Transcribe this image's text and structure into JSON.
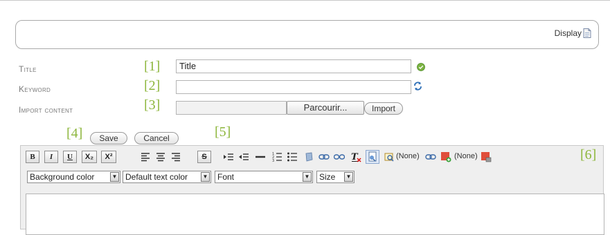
{
  "header": {
    "display_label": "Display"
  },
  "fields": {
    "title": {
      "label": "Title",
      "value": "Title"
    },
    "keyword": {
      "label": "Keyword",
      "value": ""
    },
    "import": {
      "label": "Import content",
      "browse_label": "Parcourir...",
      "import_button": "Import"
    }
  },
  "actions": {
    "save": "Save",
    "cancel": "Cancel"
  },
  "markers": {
    "m1": "[1]",
    "m2": "[2]",
    "m3": "[3]",
    "m4": "[4]",
    "m5": "[5]",
    "m6": "[6]"
  },
  "toolbar": {
    "bold": "B",
    "italic": "I",
    "underline": "U",
    "subscript": "X₂",
    "superscript": "X²",
    "strike": "S",
    "none_label_1": "(None)",
    "none_label_2": "(None)",
    "icons": [
      "bold-icon",
      "italic-icon",
      "underline-icon",
      "subscript-icon",
      "superscript-icon",
      "align-left-icon",
      "align-center-icon",
      "align-right-icon",
      "strikethrough-icon",
      "indent-icon",
      "outdent-icon",
      "horizontal-rule-icon",
      "ordered-list-icon",
      "unordered-list-icon",
      "image-icon",
      "link-icon",
      "unlink-icon",
      "remove-format-icon",
      "source-icon",
      "anchor-icon",
      "link-small-icon",
      "add-color-icon",
      "remove-color-icon"
    ],
    "selects": {
      "background_color": "Background color",
      "text_color": "Default text color",
      "font": "Font",
      "size": "Size"
    }
  },
  "colors": {
    "marker_green": "#8db63c",
    "accent_blue": "#2e6fb7"
  }
}
